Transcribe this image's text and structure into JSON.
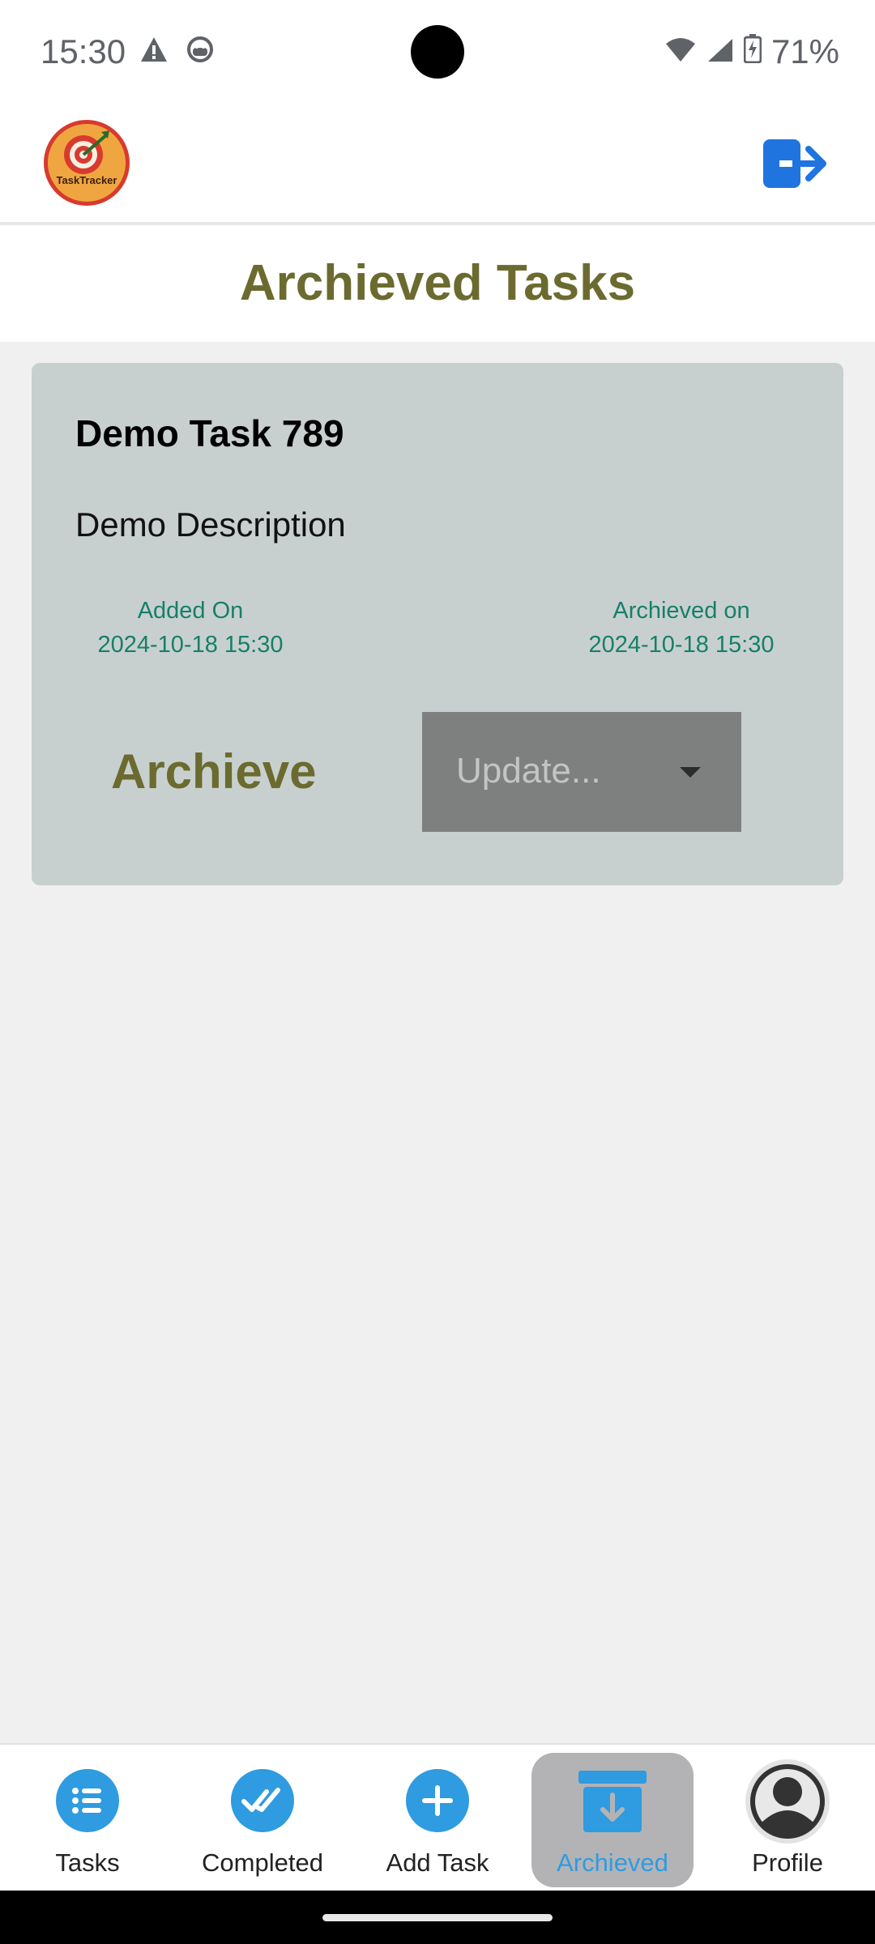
{
  "status_bar": {
    "time": "15:30",
    "battery": "71%",
    "icons": [
      "warning-icon",
      "android-head-icon",
      "wifi-icon",
      "signal-icon",
      "battery-charging-icon"
    ]
  },
  "header": {
    "logo_text": "TaskTracker",
    "logout_icon": "logout-icon"
  },
  "page": {
    "title": "Archieved Tasks"
  },
  "tasks": [
    {
      "title": "Demo Task 789",
      "description": "Demo Description",
      "added_label": "Added On",
      "added_date": "2024-10-18 15:30",
      "archived_label": "Archieved on",
      "archived_date": "2024-10-18 15:30",
      "status_label": "Archieve",
      "update_placeholder": "Update..."
    }
  ],
  "bottom_nav": {
    "items": [
      {
        "label": "Tasks",
        "icon": "list-icon"
      },
      {
        "label": "Completed",
        "icon": "double-check-icon"
      },
      {
        "label": "Add Task",
        "icon": "plus-icon"
      },
      {
        "label": "Archieved",
        "icon": "archive-box-icon",
        "active": true
      },
      {
        "label": "Profile",
        "icon": "user-avatar-icon"
      }
    ]
  },
  "colors": {
    "title_olive": "#6b6b2f",
    "accent_blue": "#2f9be0",
    "date_teal": "#168069",
    "card_bg": "#c8d0cf"
  }
}
